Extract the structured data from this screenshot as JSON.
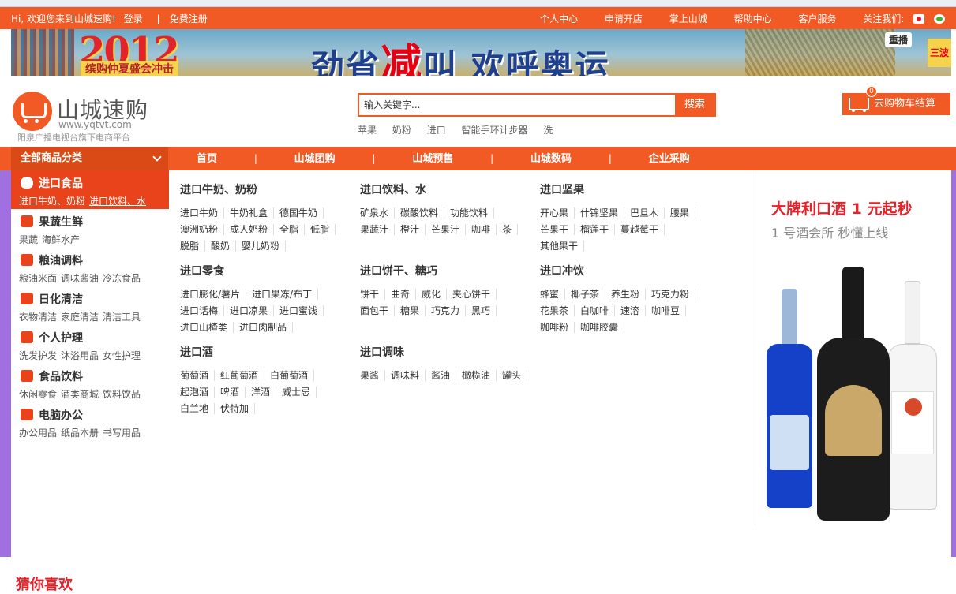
{
  "topbar": {
    "welcome": "Hi, 欢迎您来到山城速购!",
    "login": "登录",
    "separator": "|",
    "register": "免费注册",
    "links": [
      "个人中心",
      "申请开店",
      "掌上山城",
      "帮助中心",
      "客户服务",
      "关注我们:"
    ],
    "social_icons": [
      "weibo-icon",
      "wechat-icon"
    ]
  },
  "banner": {
    "year": "2012",
    "subtitle": "缤购仲夏盛会冲击",
    "slogan_pre": "劲省",
    "slogan_red": "减",
    "slogan_post": "叫 欢呼奥运",
    "replay": "重播",
    "badge": "三波"
  },
  "logo": {
    "name": "山城速购",
    "url": "www.yqtvt.com",
    "slogan": "阳泉广播电视台旗下电商平台"
  },
  "search": {
    "placeholder": "输入关键字...",
    "button": "搜索",
    "hotwords": [
      "苹果",
      "奶粉",
      "进口",
      "智能手环计步器",
      "洗"
    ]
  },
  "cart": {
    "label": "去购物车结算",
    "count": "0"
  },
  "nav": {
    "categories_title": "全部商品分类",
    "items": [
      "首页",
      "山城团购",
      "山城预售",
      "山城数码",
      "企业采购"
    ],
    "separator": "|"
  },
  "categories": [
    {
      "name": "进口食品",
      "subs": [
        "进口牛奶、奶粉",
        "进口饮料、水"
      ]
    },
    {
      "name": "果蔬生鲜",
      "subs": [
        "果蔬",
        "海鲜水产"
      ]
    },
    {
      "name": "粮油调料",
      "subs": [
        "粮油米面",
        "调味酱油",
        "冷冻食品"
      ]
    },
    {
      "name": "日化清洁",
      "subs": [
        "衣物清洁",
        "家庭清洁",
        "清洁工具"
      ]
    },
    {
      "name": "个人护理",
      "subs": [
        "洗发护发",
        "沐浴用品",
        "女性护理"
      ]
    },
    {
      "name": "食品饮料",
      "subs": [
        "休闲零食",
        "酒类商城",
        "饮料饮品"
      ]
    },
    {
      "name": "电脑办公",
      "subs": [
        "办公用品",
        "纸品本册",
        "书写用品"
      ]
    }
  ],
  "panel": {
    "groups": [
      {
        "title": "进口牛奶、奶粉",
        "items": [
          "进口牛奶",
          "牛奶礼盒",
          "德国牛奶",
          "澳洲奶粉",
          "成人奶粉",
          "全脂",
          "低脂",
          "脱脂",
          "酸奶",
          "婴儿奶粉"
        ]
      },
      {
        "title": "进口饮料、水",
        "items": [
          "矿泉水",
          "碳酸饮料",
          "功能饮料",
          "果蔬汁",
          "橙汁",
          "芒果汁",
          "咖啡",
          "茶"
        ]
      },
      {
        "title": "进口坚果",
        "items": [
          "开心果",
          "什锦坚果",
          "巴旦木",
          "腰果",
          "芒果干",
          "榴莲干",
          "蔓越莓干",
          "其他果干"
        ]
      },
      {
        "title": "进口零食",
        "items": [
          "进口膨化/薯片",
          "进口果冻/布丁",
          "进口话梅",
          "进口凉果",
          "进口蜜饯",
          "进口山楂类",
          "进口肉制品"
        ]
      },
      {
        "title": "进口饼干、糖巧",
        "items": [
          "饼干",
          "曲奇",
          "威化",
          "夹心饼干",
          "面包干",
          "糖果",
          "巧克力",
          "黑巧"
        ]
      },
      {
        "title": "进口冲饮",
        "items": [
          "蜂蜜",
          "椰子茶",
          "养生粉",
          "巧克力粉",
          "花果茶",
          "白咖啡",
          "速溶",
          "咖啡豆",
          "咖啡粉",
          "咖啡胶囊"
        ]
      },
      {
        "title": "进口酒",
        "items": [
          "葡萄酒",
          "红葡萄酒",
          "白葡萄酒",
          "起泡酒",
          "啤酒",
          "洋酒",
          "威士忌",
          "白兰地",
          "伏特加"
        ]
      },
      {
        "title": "进口调味",
        "items": [
          "果酱",
          "调味料",
          "酱油",
          "橄榄油",
          "罐头"
        ]
      }
    ]
  },
  "ad": {
    "title": "大牌利口酒 1 元起秒",
    "subtitle": "1 号酒会所 秒懂上线"
  },
  "section": {
    "guess_title": "猜你喜欢"
  },
  "colors": {
    "brand": "#f15a24",
    "nav_dark": "#d94a16",
    "accent_red": "#e62129",
    "side_strip": "#a070e0"
  }
}
